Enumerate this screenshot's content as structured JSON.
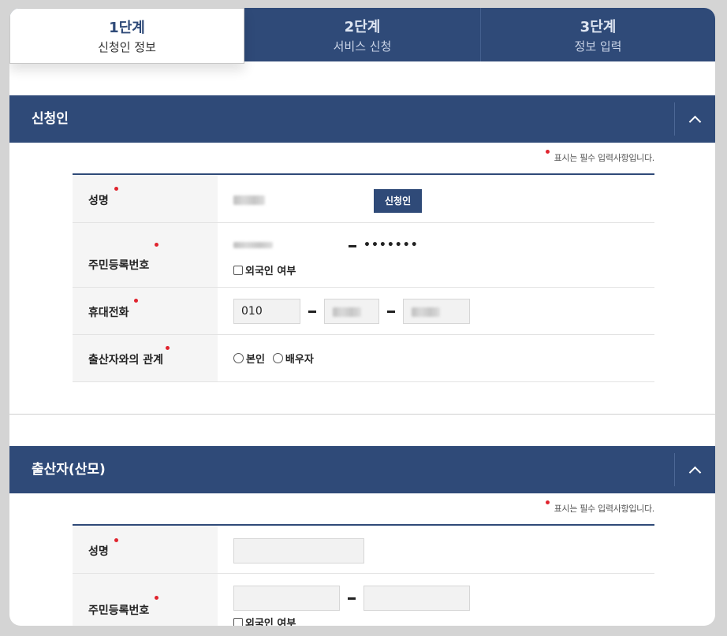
{
  "steps": [
    {
      "num": "1단계",
      "label": "신청인 정보"
    },
    {
      "num": "2단계",
      "label": "서비스 신청"
    },
    {
      "num": "3단계",
      "label": "정보 입력"
    }
  ],
  "colors": {
    "primary": "#2f4a78",
    "required_dot": "#e0242e"
  },
  "required_note": "표시는 필수 입력사항입니다.",
  "section_applicant": {
    "title": "신청인",
    "name_label": "성명",
    "applicant_button": "신청인",
    "rrn_label": "주민등록번호",
    "rrn_back_masked": "•••••••",
    "foreigner_label": "외국인 여부",
    "phone_label": "휴대전화",
    "phone_prefix": "010",
    "relation_label": "출산자와의 관계",
    "relation_options": [
      "본인",
      "배우자"
    ]
  },
  "section_mother": {
    "title": "출산자(산모)",
    "name_label": "성명",
    "rrn_label": "주민등록번호",
    "foreigner_label": "외국인 여부"
  },
  "icons": {
    "collapse": "chevron-up-icon"
  }
}
